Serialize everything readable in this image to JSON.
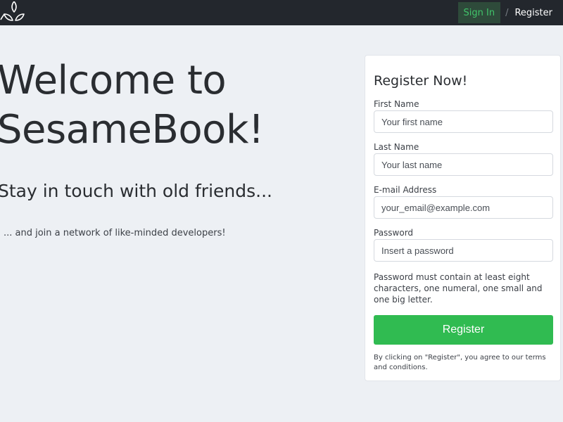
{
  "header": {
    "logo_icon": "leaf-logo-icon",
    "nav": {
      "signin_label": "Sign In",
      "separator": "/",
      "register_label": "Register"
    },
    "colors": {
      "bar": "#23272d",
      "signin_text": "#41c46a"
    }
  },
  "hero": {
    "title_line1": "Welcome to",
    "title_line2": "SesameBook!",
    "subtitle": "Stay in touch with old friends...",
    "text": "... and join a network of like-minded developers!"
  },
  "register_form": {
    "title": "Register Now!",
    "first_name": {
      "label": "First Name",
      "placeholder": "Your first name",
      "value": ""
    },
    "last_name": {
      "label": "Last Name",
      "placeholder": "Your last name",
      "value": ""
    },
    "email": {
      "label": "E-mail Address",
      "placeholder": "your_email@example.com",
      "value": ""
    },
    "password": {
      "label": "Password",
      "placeholder": "Insert a password",
      "value": ""
    },
    "password_hint": "Password must contain at least eight characters, one numeral, one small and one big letter.",
    "submit_label": "Register",
    "terms_text": "By clicking on \"Register\", you agree to our terms and conditions.",
    "colors": {
      "submit_button": "#30bb51"
    }
  }
}
